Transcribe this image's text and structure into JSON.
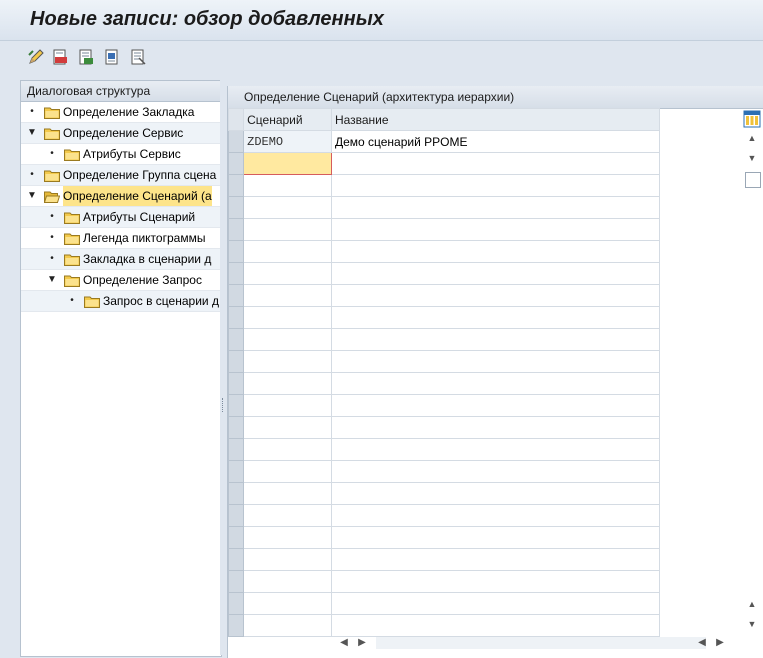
{
  "window": {
    "title": "Новые записи: обзор добавленных"
  },
  "toolbar": {
    "buttons": [
      {
        "icon": "edit-pencil-icon"
      },
      {
        "icon": "delete-icon"
      },
      {
        "icon": "copy-icon"
      },
      {
        "icon": "select-block-icon"
      },
      {
        "icon": "deselect-icon"
      }
    ]
  },
  "tree": {
    "header": "Диалоговая структура",
    "items": [
      {
        "label": "Определение Закладка",
        "level": 0,
        "marker": "•",
        "open": false,
        "selected": false
      },
      {
        "label": "Определение Сервис",
        "level": 0,
        "marker": "▼",
        "open": false,
        "selected": false
      },
      {
        "label": "Атрибуты Сервис",
        "level": 1,
        "marker": "•",
        "open": false,
        "selected": false
      },
      {
        "label": "Определение Группа сцена",
        "level": 0,
        "marker": "•",
        "open": false,
        "selected": false
      },
      {
        "label": "Определение Сценарий (а",
        "level": 0,
        "marker": "▼",
        "open": true,
        "selected": true
      },
      {
        "label": "Атрибуты Сценарий",
        "level": 1,
        "marker": "•",
        "open": false,
        "selected": false
      },
      {
        "label": "Легенда пиктограммы",
        "level": 1,
        "marker": "•",
        "open": false,
        "selected": false
      },
      {
        "label": "Закладка в сценарии д",
        "level": 1,
        "marker": "•",
        "open": false,
        "selected": false
      },
      {
        "label": "Определение Запрос",
        "level": 1,
        "marker": "▼",
        "open": false,
        "selected": false
      },
      {
        "label": "Запрос в сценарии д",
        "level": 2,
        "marker": "•",
        "open": false,
        "selected": false
      }
    ]
  },
  "table": {
    "title": "Определение Сценарий (архитектура иерархии)",
    "columns": [
      "Сценарий",
      "Название"
    ],
    "rows": [
      [
        "ZDEMO",
        "Демо сценарий PPOME"
      ],
      [
        "",
        ""
      ],
      [
        "",
        ""
      ],
      [
        "",
        ""
      ],
      [
        "",
        ""
      ],
      [
        "",
        ""
      ],
      [
        "",
        ""
      ],
      [
        "",
        ""
      ],
      [
        "",
        ""
      ],
      [
        "",
        ""
      ],
      [
        "",
        ""
      ],
      [
        "",
        ""
      ],
      [
        "",
        ""
      ],
      [
        "",
        ""
      ],
      [
        "",
        ""
      ],
      [
        "",
        ""
      ],
      [
        "",
        ""
      ],
      [
        "",
        ""
      ],
      [
        "",
        ""
      ],
      [
        "",
        ""
      ],
      [
        "",
        ""
      ],
      [
        "",
        ""
      ],
      [
        "",
        ""
      ]
    ],
    "active_row": 1
  },
  "colors": {
    "background": "#dfe6ef",
    "selection": "#fde48a",
    "active_cell": "#ffe9a0",
    "folder": "#f3c94b"
  }
}
